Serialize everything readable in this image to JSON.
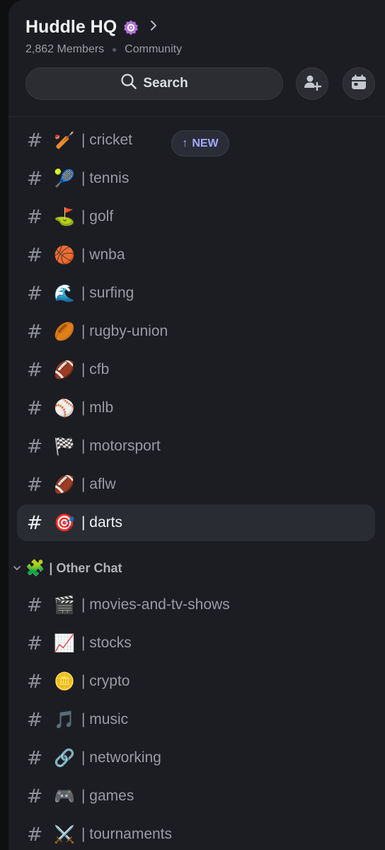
{
  "server": {
    "name": "Huddle HQ",
    "badge_icon": "community-badge-icon",
    "member_count": "2,862 Members",
    "type": "Community"
  },
  "search": {
    "label": "Search"
  },
  "actions": {
    "invite_icon": "add-member-icon",
    "events_icon": "calendar-icon"
  },
  "new_pill": {
    "arrow": "↑",
    "label": "NEW"
  },
  "sports_channels": [
    {
      "emoji": "🏏",
      "name": "| cricket"
    },
    {
      "emoji": "🎾",
      "name": "| tennis"
    },
    {
      "emoji": "⛳",
      "name": "| golf"
    },
    {
      "emoji": "🏀",
      "name": "| wnba"
    },
    {
      "emoji": "🌊",
      "name": "| surfing"
    },
    {
      "emoji": "🏉",
      "name": "| rugby-union"
    },
    {
      "emoji": "🏈",
      "name": "| cfb"
    },
    {
      "emoji": "⚾",
      "name": "| mlb"
    },
    {
      "emoji": "🏁",
      "name": "| motorsport"
    },
    {
      "emoji": "🏈",
      "name": "| aflw"
    },
    {
      "emoji": "🎯",
      "name": "| darts"
    }
  ],
  "selected_channel": "| darts",
  "category": {
    "emoji": "🧩",
    "name": "| Other Chat"
  },
  "other_channels": [
    {
      "emoji": "🎬",
      "name": "| movies-and-tv-shows"
    },
    {
      "emoji": "📈",
      "name": "| stocks"
    },
    {
      "emoji": "🪙",
      "name": "| crypto"
    },
    {
      "emoji": "🎵",
      "name": "| music"
    },
    {
      "emoji": "🔗",
      "name": "| networking"
    },
    {
      "emoji": "🎮",
      "name": "| games"
    },
    {
      "emoji": "⚔️",
      "name": "| tournaments"
    }
  ],
  "colors": {
    "background": "#1c1d22",
    "accent": "#a3a8ff",
    "badge": "#b073d9"
  }
}
